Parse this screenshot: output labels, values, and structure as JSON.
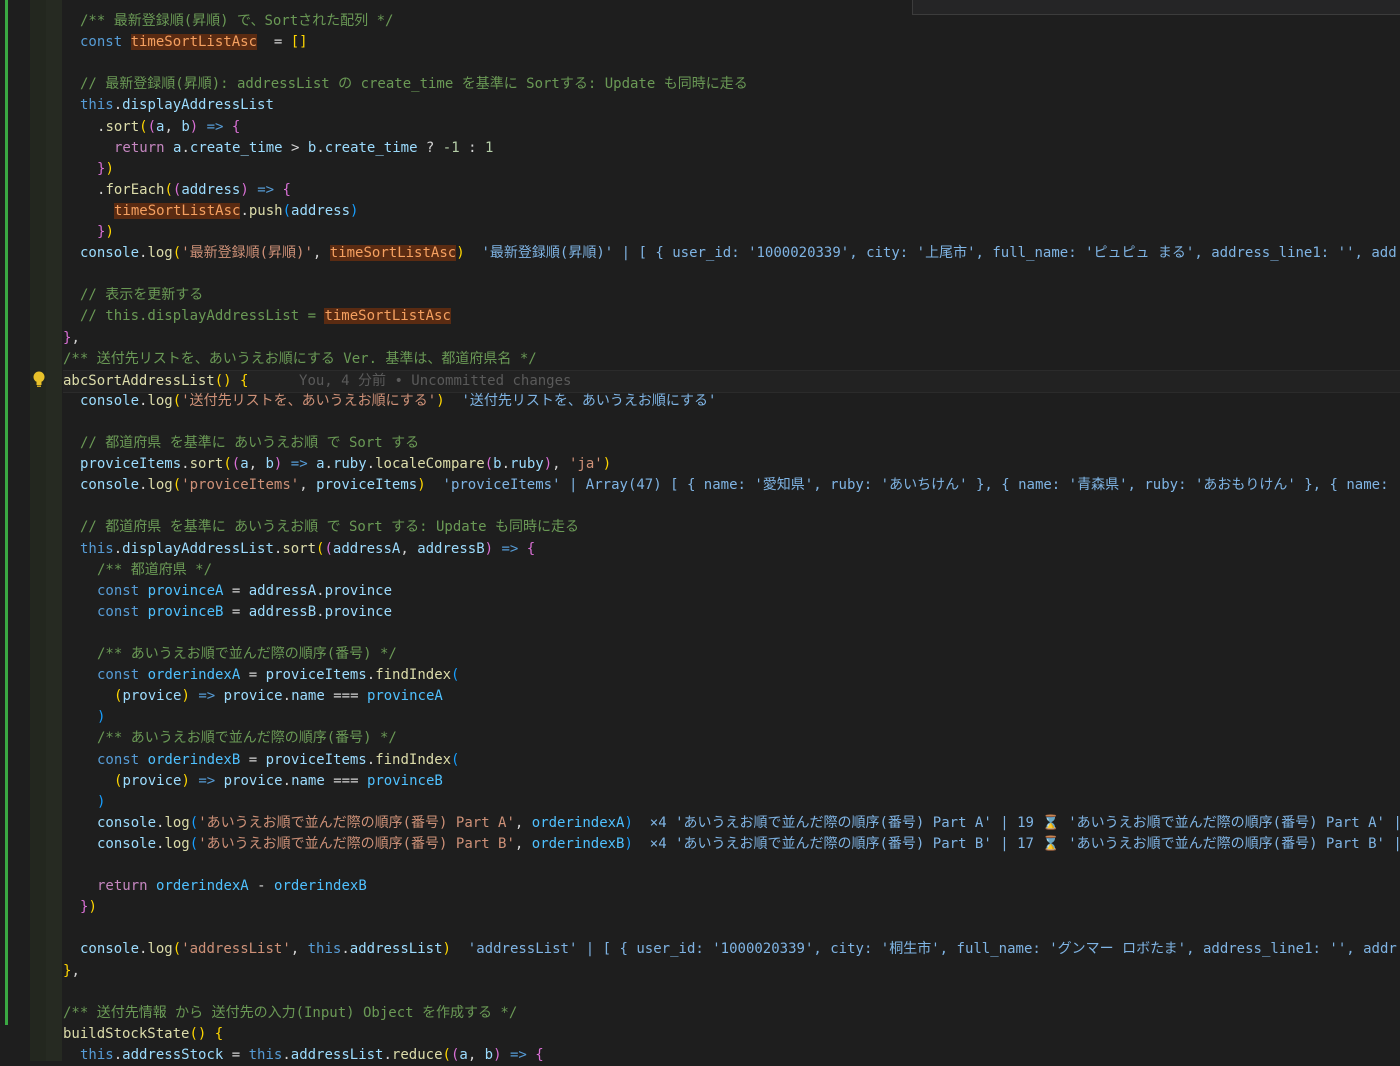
{
  "editor": {
    "blame": "You, 4 分前 • Uncommitted changes",
    "lines": [
      {
        "indent": 1,
        "tokens": [
          [
            "c-com",
            "/** 最新登録順(昇順) で、Sortされた配列 */"
          ]
        ]
      },
      {
        "indent": 1,
        "tokens": [
          [
            "c-kw",
            "const "
          ],
          [
            "hl",
            "timeSortListAsc"
          ],
          [
            "",
            "  = "
          ],
          [
            "c-par1",
            "[]"
          ]
        ]
      },
      {
        "indent": 0,
        "tokens": []
      },
      {
        "indent": 1,
        "tokens": [
          [
            "c-com",
            "// 最新登録順(昇順): addressList の create_time を基準に Sortする: Update も同時に走る"
          ]
        ]
      },
      {
        "indent": 1,
        "tokens": [
          [
            "c-kw",
            "this"
          ],
          [
            "",
            "."
          ],
          [
            "c-var",
            "displayAddressList"
          ]
        ]
      },
      {
        "indent": 2,
        "tokens": [
          [
            "",
            "."
          ],
          [
            "c-fn",
            "sort"
          ],
          [
            "c-par1",
            "("
          ],
          [
            "c-par2",
            "("
          ],
          [
            "c-var",
            "a"
          ],
          [
            "",
            ", "
          ],
          [
            "c-var",
            "b"
          ],
          [
            "c-par2",
            ")"
          ],
          [
            "c-kw",
            " => "
          ],
          [
            "c-par2",
            "{"
          ]
        ]
      },
      {
        "indent": 3,
        "tokens": [
          [
            "c-ctl",
            "return "
          ],
          [
            "c-var",
            "a"
          ],
          [
            "",
            "."
          ],
          [
            "c-var",
            "create_time"
          ],
          [
            "",
            " > "
          ],
          [
            "c-var",
            "b"
          ],
          [
            "",
            "."
          ],
          [
            "c-var",
            "create_time"
          ],
          [
            "",
            " ? "
          ],
          [
            "c-num",
            "-1"
          ],
          [
            "",
            " : "
          ],
          [
            "c-num",
            "1"
          ]
        ]
      },
      {
        "indent": 2,
        "tokens": [
          [
            "c-par2",
            "}"
          ],
          [
            "c-par1",
            ")"
          ]
        ]
      },
      {
        "indent": 2,
        "tokens": [
          [
            "",
            "."
          ],
          [
            "c-fn",
            "forEach"
          ],
          [
            "c-par1",
            "("
          ],
          [
            "c-par2",
            "("
          ],
          [
            "c-var",
            "address"
          ],
          [
            "c-par2",
            ")"
          ],
          [
            "c-kw",
            " => "
          ],
          [
            "c-par2",
            "{"
          ]
        ]
      },
      {
        "indent": 3,
        "tokens": [
          [
            "hl",
            "timeSortListAsc"
          ],
          [
            "",
            "."
          ],
          [
            "c-fn",
            "push"
          ],
          [
            "c-par3",
            "("
          ],
          [
            "c-var",
            "address"
          ],
          [
            "c-par3",
            ")"
          ]
        ]
      },
      {
        "indent": 2,
        "tokens": [
          [
            "c-par2",
            "}"
          ],
          [
            "c-par1",
            ")"
          ]
        ]
      },
      {
        "indent": 1,
        "tokens": [
          [
            "c-var",
            "console"
          ],
          [
            "",
            "."
          ],
          [
            "c-fn",
            "log"
          ],
          [
            "c-par1",
            "("
          ],
          [
            "c-str",
            "'最新登録順(昇順)'"
          ],
          [
            "",
            ", "
          ],
          [
            "hl",
            "timeSortListAsc"
          ],
          [
            "c-par1",
            ")"
          ],
          [
            "hint",
            "  '最新登録順(昇順)' | [ { user_id: '1000020339', city: '上尾市', full_name: 'ピュピュ まる', address_line1: '', add"
          ]
        ]
      },
      {
        "indent": 0,
        "tokens": []
      },
      {
        "indent": 1,
        "tokens": [
          [
            "c-com",
            "// 表示を更新する"
          ]
        ]
      },
      {
        "indent": 1,
        "tokens": [
          [
            "c-com",
            "// this.displayAddressList = "
          ],
          [
            "hl",
            "timeSortListAsc"
          ]
        ]
      },
      {
        "indent": 0,
        "tokens": [
          [
            "c-par2",
            "}"
          ],
          [
            "",
            ","
          ]
        ]
      },
      {
        "indent": 0,
        "tokens": [
          [
            "c-com",
            "/** 送付先リストを、あいうえお順にする Ver. 基準は、都道府県名 */"
          ]
        ]
      },
      {
        "indent": 0,
        "current": true,
        "tokens": [
          [
            "c-fn",
            "abcSortAddressList"
          ],
          [
            "c-par1",
            "()"
          ],
          [
            "",
            " "
          ],
          [
            "c-par1",
            "{"
          ]
        ],
        "blame": true
      },
      {
        "indent": 1,
        "tokens": [
          [
            "c-var",
            "console"
          ],
          [
            "",
            "."
          ],
          [
            "c-fn",
            "log"
          ],
          [
            "c-par1",
            "("
          ],
          [
            "c-str",
            "'送付先リストを、あいうえお順にする'"
          ],
          [
            "c-par1",
            ")"
          ],
          [
            "hint",
            "  '送付先リストを、あいうえお順にする'"
          ]
        ]
      },
      {
        "indent": 0,
        "tokens": []
      },
      {
        "indent": 1,
        "tokens": [
          [
            "c-com",
            "// 都道府県 を基準に あいうえお順 で Sort する"
          ]
        ]
      },
      {
        "indent": 1,
        "tokens": [
          [
            "c-var",
            "proviceItems"
          ],
          [
            "",
            "."
          ],
          [
            "c-fn",
            "sort"
          ],
          [
            "c-par1",
            "("
          ],
          [
            "c-par2",
            "("
          ],
          [
            "c-var",
            "a"
          ],
          [
            "",
            ", "
          ],
          [
            "c-var",
            "b"
          ],
          [
            "c-par2",
            ")"
          ],
          [
            "c-kw",
            " => "
          ],
          [
            "c-var",
            "a"
          ],
          [
            "",
            "."
          ],
          [
            "c-var",
            "ruby"
          ],
          [
            "",
            "."
          ],
          [
            "c-fn",
            "localeCompare"
          ],
          [
            "c-par2",
            "("
          ],
          [
            "c-var",
            "b"
          ],
          [
            "",
            "."
          ],
          [
            "c-var",
            "ruby"
          ],
          [
            "c-par2",
            ")"
          ],
          [
            "",
            ", "
          ],
          [
            "c-str",
            "'ja'"
          ],
          [
            "c-par1",
            ")"
          ]
        ]
      },
      {
        "indent": 1,
        "tokens": [
          [
            "c-var",
            "console"
          ],
          [
            "",
            "."
          ],
          [
            "c-fn",
            "log"
          ],
          [
            "c-par1",
            "("
          ],
          [
            "c-str",
            "'proviceItems'"
          ],
          [
            "",
            ", "
          ],
          [
            "c-var",
            "proviceItems"
          ],
          [
            "c-par1",
            ")"
          ],
          [
            "hint",
            "  'proviceItems' | Array(47) [ { name: '愛知県', ruby: 'あいちけん' }, { name: '青森県', ruby: 'あおもりけん' }, { name:"
          ]
        ]
      },
      {
        "indent": 0,
        "tokens": []
      },
      {
        "indent": 1,
        "tokens": [
          [
            "c-com",
            "// 都道府県 を基準に あいうえお順 で Sort する: Update も同時に走る"
          ]
        ]
      },
      {
        "indent": 1,
        "tokens": [
          [
            "c-kw",
            "this"
          ],
          [
            "",
            "."
          ],
          [
            "c-var",
            "displayAddressList"
          ],
          [
            "",
            "."
          ],
          [
            "c-fn",
            "sort"
          ],
          [
            "c-par1",
            "("
          ],
          [
            "c-par2",
            "("
          ],
          [
            "c-var",
            "addressA"
          ],
          [
            "",
            ", "
          ],
          [
            "c-var",
            "addressB"
          ],
          [
            "c-par2",
            ")"
          ],
          [
            "c-kw",
            " => "
          ],
          [
            "c-par2",
            "{"
          ]
        ]
      },
      {
        "indent": 2,
        "tokens": [
          [
            "c-com",
            "/** 都道府県 */"
          ]
        ]
      },
      {
        "indent": 2,
        "tokens": [
          [
            "c-kw",
            "const "
          ],
          [
            "c-const",
            "provinceA"
          ],
          [
            "",
            " = "
          ],
          [
            "c-var",
            "addressA"
          ],
          [
            "",
            "."
          ],
          [
            "c-var",
            "province"
          ]
        ]
      },
      {
        "indent": 2,
        "tokens": [
          [
            "c-kw",
            "const "
          ],
          [
            "c-const",
            "provinceB"
          ],
          [
            "",
            " = "
          ],
          [
            "c-var",
            "addressB"
          ],
          [
            "",
            "."
          ],
          [
            "c-var",
            "province"
          ]
        ]
      },
      {
        "indent": 0,
        "tokens": []
      },
      {
        "indent": 2,
        "tokens": [
          [
            "c-com",
            "/** あいうえお順で並んだ際の順序(番号) */"
          ]
        ]
      },
      {
        "indent": 2,
        "tokens": [
          [
            "c-kw",
            "const "
          ],
          [
            "c-const",
            "orderindexA"
          ],
          [
            "",
            " = "
          ],
          [
            "c-var",
            "proviceItems"
          ],
          [
            "",
            "."
          ],
          [
            "c-fn",
            "findIndex"
          ],
          [
            "c-par3",
            "("
          ]
        ]
      },
      {
        "indent": 3,
        "tokens": [
          [
            "c-par1",
            "("
          ],
          [
            "c-var",
            "provice"
          ],
          [
            "c-par1",
            ")"
          ],
          [
            "c-kw",
            " => "
          ],
          [
            "c-var",
            "provice"
          ],
          [
            "",
            "."
          ],
          [
            "c-var",
            "name"
          ],
          [
            "",
            " === "
          ],
          [
            "c-const",
            "provinceA"
          ]
        ]
      },
      {
        "indent": 2,
        "tokens": [
          [
            "c-par3",
            ")"
          ]
        ]
      },
      {
        "indent": 2,
        "tokens": [
          [
            "c-com",
            "/** あいうえお順で並んだ際の順序(番号) */"
          ]
        ]
      },
      {
        "indent": 2,
        "tokens": [
          [
            "c-kw",
            "const "
          ],
          [
            "c-const",
            "orderindexB"
          ],
          [
            "",
            " = "
          ],
          [
            "c-var",
            "proviceItems"
          ],
          [
            "",
            "."
          ],
          [
            "c-fn",
            "findIndex"
          ],
          [
            "c-par3",
            "("
          ]
        ]
      },
      {
        "indent": 3,
        "tokens": [
          [
            "c-par1",
            "("
          ],
          [
            "c-var",
            "provice"
          ],
          [
            "c-par1",
            ")"
          ],
          [
            "c-kw",
            " => "
          ],
          [
            "c-var",
            "provice"
          ],
          [
            "",
            "."
          ],
          [
            "c-var",
            "name"
          ],
          [
            "",
            " === "
          ],
          [
            "c-const",
            "provinceB"
          ]
        ]
      },
      {
        "indent": 2,
        "tokens": [
          [
            "c-par3",
            ")"
          ]
        ]
      },
      {
        "indent": 2,
        "tokens": [
          [
            "c-var",
            "console"
          ],
          [
            "",
            "."
          ],
          [
            "c-fn",
            "log"
          ],
          [
            "c-par3",
            "("
          ],
          [
            "c-str",
            "'あいうえお順で並んだ際の順序(番号) Part A'"
          ],
          [
            "",
            ", "
          ],
          [
            "c-const",
            "orderindexA"
          ],
          [
            "c-par3",
            ")"
          ],
          [
            "hint",
            "  ×4 'あいうえお順で並んだ際の順序(番号) Part A' | 19 ⌛ 'あいうえお順で並んだ際の順序(番号) Part A' |"
          ]
        ]
      },
      {
        "indent": 2,
        "tokens": [
          [
            "c-var",
            "console"
          ],
          [
            "",
            "."
          ],
          [
            "c-fn",
            "log"
          ],
          [
            "c-par3",
            "("
          ],
          [
            "c-str",
            "'あいうえお順で並んだ際の順序(番号) Part B'"
          ],
          [
            "",
            ", "
          ],
          [
            "c-const",
            "orderindexB"
          ],
          [
            "c-par3",
            ")"
          ],
          [
            "hint",
            "  ×4 'あいうえお順で並んだ際の順序(番号) Part B' | 17 ⌛ 'あいうえお順で並んだ際の順序(番号) Part B' |"
          ]
        ]
      },
      {
        "indent": 0,
        "tokens": []
      },
      {
        "indent": 2,
        "tokens": [
          [
            "c-ctl",
            "return "
          ],
          [
            "c-const",
            "orderindexA"
          ],
          [
            "",
            " - "
          ],
          [
            "c-const",
            "orderindexB"
          ]
        ]
      },
      {
        "indent": 1,
        "tokens": [
          [
            "c-par2",
            "}"
          ],
          [
            "c-par1",
            ")"
          ]
        ]
      },
      {
        "indent": 0,
        "tokens": []
      },
      {
        "indent": 1,
        "tokens": [
          [
            "c-var",
            "console"
          ],
          [
            "",
            "."
          ],
          [
            "c-fn",
            "log"
          ],
          [
            "c-par1",
            "("
          ],
          [
            "c-str",
            "'addressList'"
          ],
          [
            "",
            ", "
          ],
          [
            "c-kw",
            "this"
          ],
          [
            "",
            "."
          ],
          [
            "c-var",
            "addressList"
          ],
          [
            "c-par1",
            ")"
          ],
          [
            "hint",
            "  'addressList' | [ { user_id: '1000020339', city: '桐生市', full_name: 'グンマー ロボたま', address_line1: '', addr"
          ]
        ]
      },
      {
        "indent": 0,
        "tokens": [
          [
            "c-par1",
            "}"
          ],
          [
            "",
            ","
          ]
        ]
      },
      {
        "indent": 0,
        "tokens": []
      },
      {
        "indent": 0,
        "tokens": [
          [
            "c-com",
            "/** 送付先情報 から 送付先の入力(Input) Object を作成する */"
          ]
        ]
      },
      {
        "indent": 0,
        "tokens": [
          [
            "c-fn",
            "buildStockState"
          ],
          [
            "c-par1",
            "()"
          ],
          [
            "",
            " "
          ],
          [
            "c-par1",
            "{"
          ]
        ]
      },
      {
        "indent": 1,
        "tokens": [
          [
            "c-kw",
            "this"
          ],
          [
            "",
            "."
          ],
          [
            "c-var",
            "addressStock"
          ],
          [
            "",
            " = "
          ],
          [
            "c-kw",
            "this"
          ],
          [
            "",
            "."
          ],
          [
            "c-var",
            "addressList"
          ],
          [
            "",
            "."
          ],
          [
            "c-fn",
            "reduce"
          ],
          [
            "c-par1",
            "("
          ],
          [
            "c-par2",
            "("
          ],
          [
            "c-var",
            "a"
          ],
          [
            "",
            ", "
          ],
          [
            "c-var",
            "b"
          ],
          [
            "c-par2",
            ")"
          ],
          [
            "c-kw",
            " => "
          ],
          [
            "c-par2",
            "{"
          ]
        ]
      }
    ]
  }
}
